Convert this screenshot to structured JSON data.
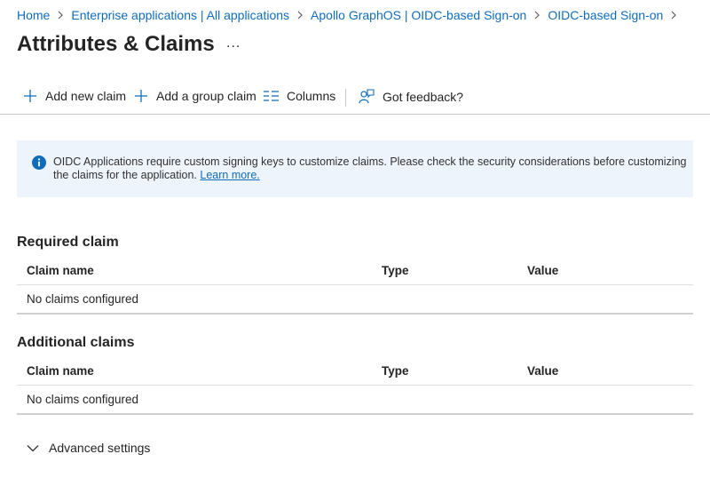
{
  "breadcrumb": {
    "items": [
      "Home",
      "Enterprise applications | All applications",
      "Apollo GraphOS | OIDC-based Sign-on",
      "OIDC-based Sign-on"
    ]
  },
  "page": {
    "title": "Attributes & Claims",
    "more_label": "..."
  },
  "toolbar": {
    "add_claim": "Add new claim",
    "add_group_claim": "Add a group claim",
    "columns": "Columns",
    "feedback": "Got feedback?"
  },
  "info": {
    "text": "OIDC Applications require custom signing keys to customize claims. Please check the security considerations before customizing the claims for the application.",
    "link": "Learn more."
  },
  "required": {
    "title": "Required claim",
    "headers": {
      "name": "Claim name",
      "type": "Type",
      "value": "Value"
    },
    "empty": "No claims configured"
  },
  "additional": {
    "title": "Additional claims",
    "headers": {
      "name": "Claim name",
      "type": "Type",
      "value": "Value"
    },
    "empty": "No claims configured"
  },
  "advanced": {
    "label": "Advanced settings"
  },
  "colors": {
    "link": "#0f6cbd",
    "info_bg": "#eef4fc",
    "info_icon": "#0f6cbd"
  }
}
